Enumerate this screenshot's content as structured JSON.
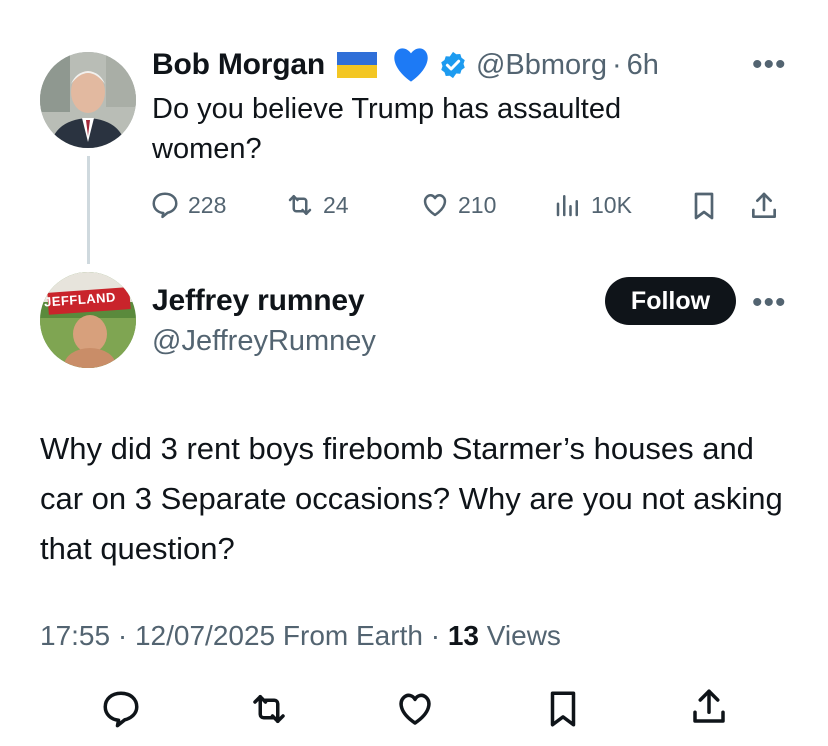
{
  "original_tweet": {
    "author_name": "Bob Morgan",
    "handle": "@Bbmorg",
    "separator": "·",
    "time_ago": "6h",
    "text": "Do you believe Trump has assaulted women?",
    "more_icon": "more-horizontal-icon",
    "stats": {
      "replies": "228",
      "retweets": "24",
      "likes": "210",
      "views": "10K"
    },
    "colors": {
      "verified": "#1d9bf0",
      "heart": "#1d7af5"
    }
  },
  "reply_tweet": {
    "author_name": "Jeffrey rumney",
    "handle": "@JeffreyRumney",
    "follow_label": "Follow",
    "avatar_sign_text": "JEFFLAND",
    "text": "Why did 3 rent boys firebomb Starmer’s houses and car on 3 Separate occasions? Why are you not asking that question?",
    "meta": {
      "time": "17:55",
      "separator": "·",
      "date": "12/07/2025",
      "source": "From Earth",
      "views_count": "13",
      "views_label": "Views"
    }
  },
  "actions": [
    "reply-icon",
    "retweet-icon",
    "like-icon",
    "bookmark-icon",
    "share-icon"
  ]
}
